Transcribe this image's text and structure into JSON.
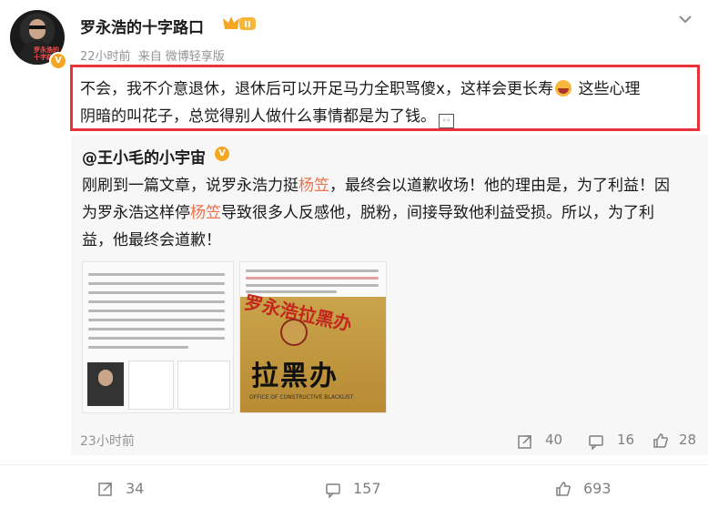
{
  "post": {
    "username": "罗永浩的十字路口",
    "level_badge": "II",
    "verified_badge": "V",
    "avatar_caption": "罗永浩的十字路口",
    "time": "22小时前",
    "source_prefix": "来自",
    "source": "微博轻享版",
    "text_line1a": "不会，我不介意退休，退休后可以开足马力全职骂傻x，这样会更长寿",
    "text_line1b": "这些心理",
    "text_line2": "阴暗的叫花子，总觉得别人做什么事情都是为了钱。"
  },
  "repost": {
    "username": "@王小毛的小宇宙",
    "verified_badge": "V",
    "line1a": "刚刷到一篇文章，说罗永浩力挺",
    "highlight1": "杨笠",
    "line1b": "，最终会以道歉收场！他的理由是，为了利益！因",
    "line2a": "为罗永浩这样停",
    "highlight2": "杨笠",
    "line2b": "导致很多人反感他，脱粉，间接导致他利益受损。所以，为了利",
    "line3": "益，他最终会道歉！",
    "thumb2_sign_vertical": "罗永浩拉黑办",
    "thumb2_sign_big": "拉黑办",
    "thumb2_sign_en": "OFFICE OF CONSTRUCTIVE BLACKLIST",
    "time": "23小时前",
    "reposts": "40",
    "comments": "16",
    "likes": "28"
  },
  "actions": {
    "reposts": "34",
    "comments": "157",
    "likes": "693"
  },
  "colors": {
    "highlight_border": "#e8323c",
    "mention_highlight": "#eb7350",
    "badge": "#f5a623"
  }
}
